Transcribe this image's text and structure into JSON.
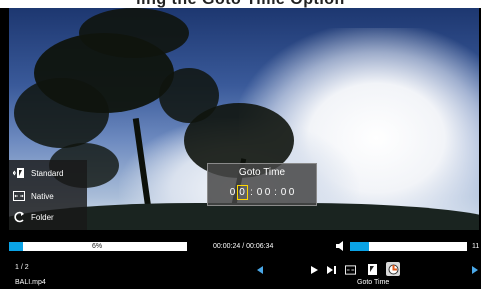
{
  "top_caption": "ling the Goto Time Option",
  "menu": {
    "items": [
      {
        "label": "Standard",
        "icon": "standard-aspect-icon"
      },
      {
        "label": "Native",
        "icon": "native-aspect-icon"
      },
      {
        "label": "Folder",
        "icon": "folder-loop-icon"
      }
    ]
  },
  "goto_dialog": {
    "title": "Goto Time",
    "digits": [
      "0",
      "0",
      ":",
      "0",
      "0",
      ":",
      "0",
      "0"
    ],
    "selected_index": 1
  },
  "progress": {
    "label": "6%",
    "fraction": 0.08
  },
  "time": {
    "display": "00:00:24 / 00:06:34"
  },
  "volume": {
    "fraction": 0.16,
    "level": "11"
  },
  "file": {
    "counter": "1 / 2",
    "name": "BALI.mp4"
  },
  "controls": {
    "buttons": [
      "play-icon",
      "next-track-icon",
      "aspect-icon",
      "goto-icon",
      "timer-icon"
    ],
    "selected_label": "Goto Time"
  },
  "colors": {
    "accent": "#0aa3e6",
    "highlight": "#ffd800"
  }
}
